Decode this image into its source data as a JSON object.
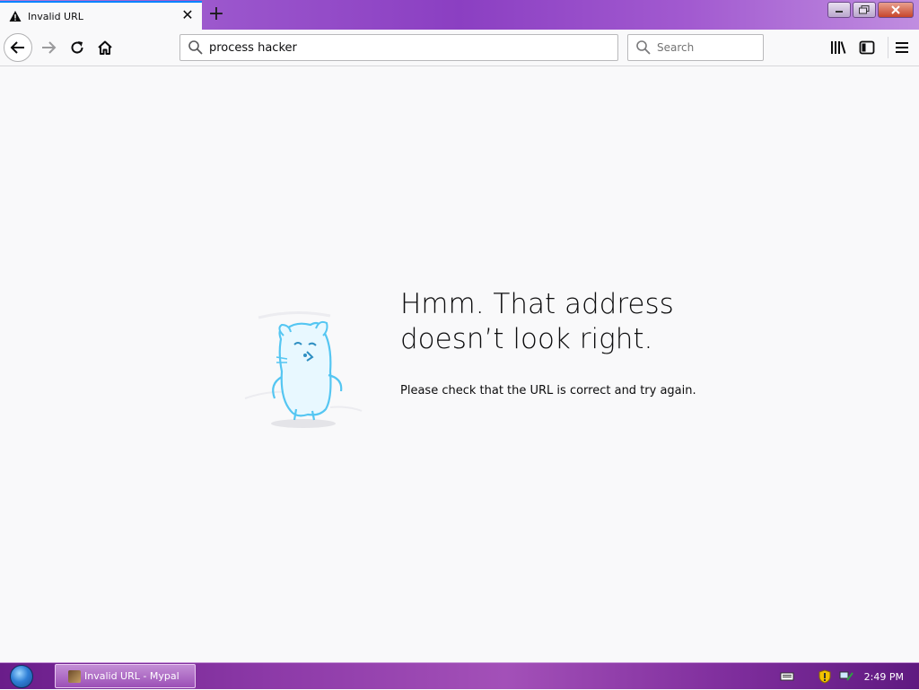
{
  "tab": {
    "title": "Invalid URL",
    "close_glyph": "✕",
    "icon": "warning-icon"
  },
  "newtab_glyph": "+",
  "window_buttons": {
    "minimize": "minimize-icon",
    "restore": "restore-icon",
    "close": "close-icon"
  },
  "navbar": {
    "url_value": "process hacker",
    "search_placeholder": "Search",
    "icons": [
      "back-arrow-icon",
      "forward-arrow-icon",
      "reload-icon",
      "home-icon",
      "library-icon",
      "sidebar-icon",
      "menu-icon"
    ]
  },
  "error": {
    "title_line1": "Hmm. That address",
    "title_line2": "doesn’t look right.",
    "description": "Please check that the URL is correct and try again."
  },
  "taskbar": {
    "item_label": "Invalid URL - Mypal",
    "clock": "2:49 PM",
    "tray_icons": [
      "keyboard-icon",
      "security-shield-icon",
      "network-icon"
    ]
  },
  "colors": {
    "accent": "#0a84ff",
    "illustration": "#55c6f2",
    "taskbar": "#8d3aa8"
  }
}
